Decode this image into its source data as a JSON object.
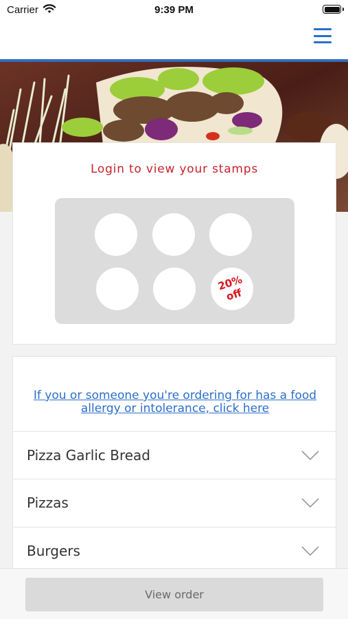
{
  "status_bar": {
    "carrier": "Carrier",
    "time": "9:39 PM"
  },
  "header": {
    "menu_icon": "hamburger-menu-icon",
    "accent_color": "#2a6fc9"
  },
  "stamps": {
    "title": "Login to view your stamps",
    "title_color": "#c8202a",
    "slots": 6,
    "reward_line1": "20%",
    "reward_line2": "off",
    "reward_color": "#d8141c"
  },
  "allergy": {
    "link_text": "If you or someone you're ordering for has a food allergy or intolerance, click here"
  },
  "categories": [
    {
      "label": "Pizza Garlic Bread",
      "icon": "chevron-down-icon"
    },
    {
      "label": "Pizzas",
      "icon": "chevron-down-icon"
    },
    {
      "label": "Burgers",
      "icon": "chevron-down-icon"
    }
  ],
  "footer": {
    "view_order_label": "View order"
  }
}
